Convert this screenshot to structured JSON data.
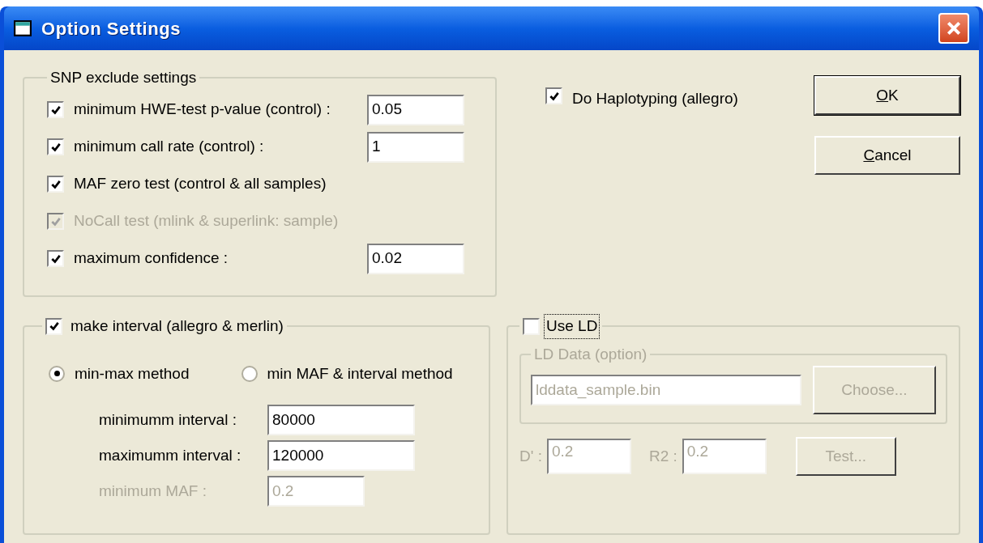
{
  "window": {
    "title": "Option Settings"
  },
  "snp_exclude": {
    "title": "SNP exclude settings",
    "items": [
      {
        "label": "minimum HWE-test p-value (control) :",
        "checked": true,
        "disabled": false,
        "value": "0.05"
      },
      {
        "label": "minimum call rate (control) :",
        "checked": true,
        "disabled": false,
        "value": "1"
      },
      {
        "label": "MAF zero test (control & all samples)",
        "checked": true,
        "disabled": false
      },
      {
        "label": "NoCall test (mlink & superlink: sample)",
        "checked": true,
        "disabled": true
      },
      {
        "label": "maximum confidence :",
        "checked": true,
        "disabled": false,
        "value": "0.02"
      }
    ]
  },
  "haplotyping": {
    "label": "Do Haplotyping (allegro)",
    "checked": true
  },
  "buttons": [
    {
      "label": "OK",
      "first_letter_underlined": true,
      "default": true
    },
    {
      "label": "Cancel",
      "first_letter_underlined": true,
      "default": false
    }
  ],
  "interval": {
    "label": "make interval (allegro & merlin)",
    "checked": true,
    "methods": [
      {
        "label": "min-max method",
        "selected": true
      },
      {
        "label": "min MAF & interval method",
        "selected": false
      }
    ],
    "fields": [
      {
        "label": "minimumm interval :",
        "value": "80000",
        "disabled": false
      },
      {
        "label": "maximumm interval :",
        "value": "120000",
        "disabled": false
      },
      {
        "label": "minimum MAF :",
        "value": "0.2",
        "disabled": true
      }
    ]
  },
  "use_ld": {
    "label": "Use LD",
    "checked": false,
    "focused": true,
    "disabled": true,
    "ld_data": {
      "title": "LD Data (option)",
      "file": "lddata_sample.bin",
      "choose_button": "Choose..."
    },
    "params": [
      {
        "label": "D' :",
        "value": "0.2"
      },
      {
        "label": "R2 :",
        "value": "0.2"
      }
    ],
    "test_button": "Test..."
  }
}
